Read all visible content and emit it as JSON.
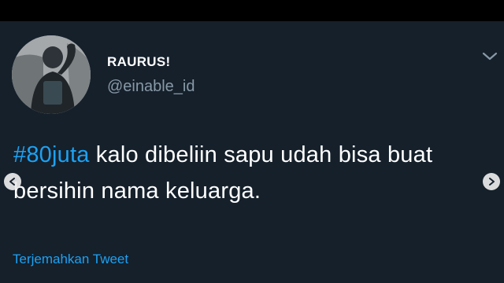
{
  "user": {
    "display_name": "RAURUS!",
    "handle": "@einable_id"
  },
  "tweet": {
    "hashtag": "#80juta",
    "text_after_hashtag": " kalo dibeliin sapu udah bisa buat bersihin nama keluarga."
  },
  "translate_label": "Terjemahkan Tweet",
  "icons": {
    "menu": "chevron-down-icon",
    "prev": "chevron-left-icon",
    "next": "chevron-right-icon"
  },
  "colors": {
    "background": "#15202b",
    "accent": "#1da1f2",
    "secondary_text": "#8899a6"
  }
}
